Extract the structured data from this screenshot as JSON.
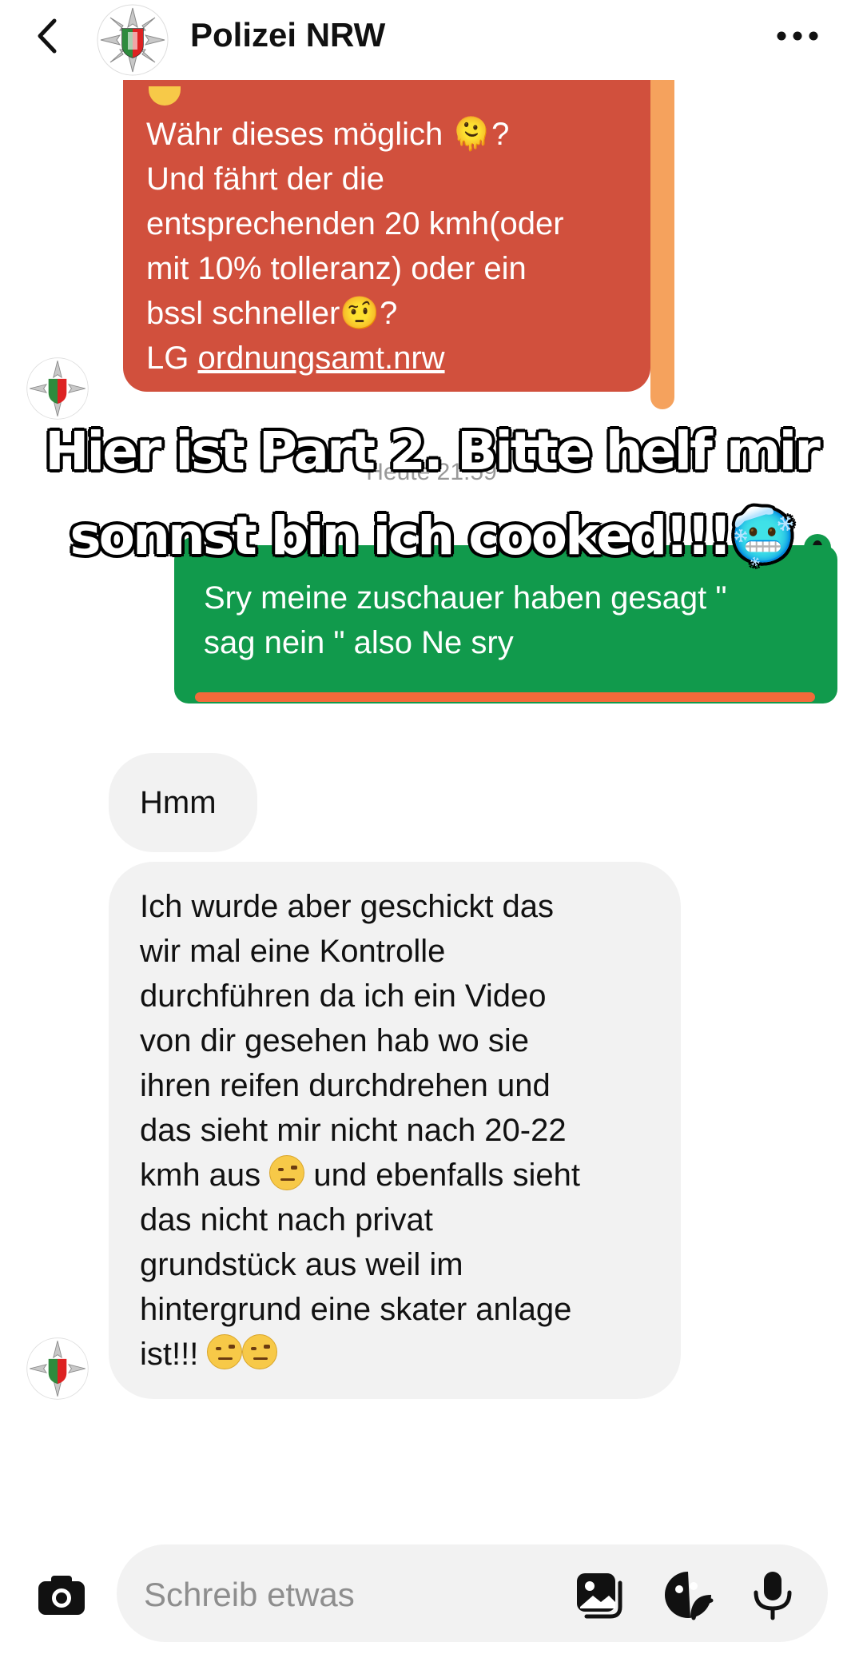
{
  "header": {
    "title": "Polizei NRW",
    "back_icon": "chevron-left-icon",
    "more_icon": "more-horizontal-icon"
  },
  "messages": {
    "red_bubble_lines": [
      "Währ dieses möglich 🫠?",
      "Und fährt der die",
      "entsprechenden 20 kmh(oder",
      "mit 10% tolleranz) oder ein",
      "bssl schneller🤨?"
    ],
    "red_bubble_signoff_prefix": "LG ",
    "red_bubble_link": "ordnungsamt.nrw",
    "timestamp": "Heute 21:59",
    "green_bubble_lines": [
      "Sry meine zuschauer haben gesagt \"",
      "sag nein \" also Ne sry"
    ],
    "grey_short": "Hmm",
    "grey_long_lines": [
      "Ich wurde aber geschickt das",
      "wir mal eine Kontrolle",
      "durchführen da ich ein Video",
      "von dir gesehen hab wo sie",
      "ihren reifen durchdrehen und",
      "das sieht mir nicht nach 20-22",
      "kmh aus",
      "und ebenfalls sieht",
      "das nicht nach privat",
      "grundstück aus weil im",
      "hintergrund eine skater anlage",
      "ist!!!"
    ]
  },
  "overlay_caption": [
    "Hier ist Part 2. Bitte helf mir",
    "sonnst bin ich cooked!!!🥶"
  ],
  "composer": {
    "placeholder": "Schreib etwas",
    "icons": [
      "camera-icon",
      "gallery-icon",
      "sticker-icon",
      "microphone-icon"
    ]
  },
  "colors": {
    "red_bubble": "#d1503d",
    "green_bubble": "#119a4c",
    "grey_bubble": "#f2f2f2",
    "accent_orange": "#f26a3a"
  }
}
